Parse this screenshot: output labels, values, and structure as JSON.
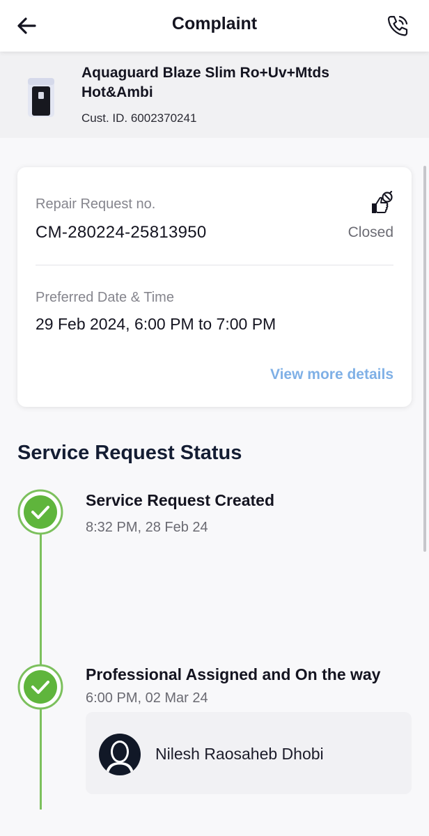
{
  "header": {
    "title": "Complaint",
    "back_icon": "arrow-left-icon",
    "call_icon": "phone-call-icon"
  },
  "product": {
    "name": "Aquaguard Blaze Slim Ro+Uv+Mtds Hot&Ambi",
    "customer_id": "Cust. ID. 6002370241"
  },
  "request_card": {
    "request_label": "Repair Request no.",
    "request_number": "CM-280224-25813950",
    "status_icon": "repair-thumbs-up-icon",
    "status": "Closed",
    "preferred_label": "Preferred Date & Time",
    "preferred_value": "29 Feb 2024, 6:00 PM to 7:00 PM",
    "view_more": "View more details"
  },
  "status_section": {
    "title": "Service Request Status",
    "steps": [
      {
        "title": "Service Request Created",
        "time": "8:32 PM, 28 Feb 24"
      },
      {
        "title": "Professional Assigned and On the way",
        "time": "6:00 PM, 02 Mar 24"
      }
    ],
    "professional": {
      "name": "Nilesh Raosaheb Dhobi"
    }
  },
  "colors": {
    "accent_link": "#7fb0e6",
    "timeline_green": "#7cc05d",
    "check_green": "#5fb53c"
  }
}
